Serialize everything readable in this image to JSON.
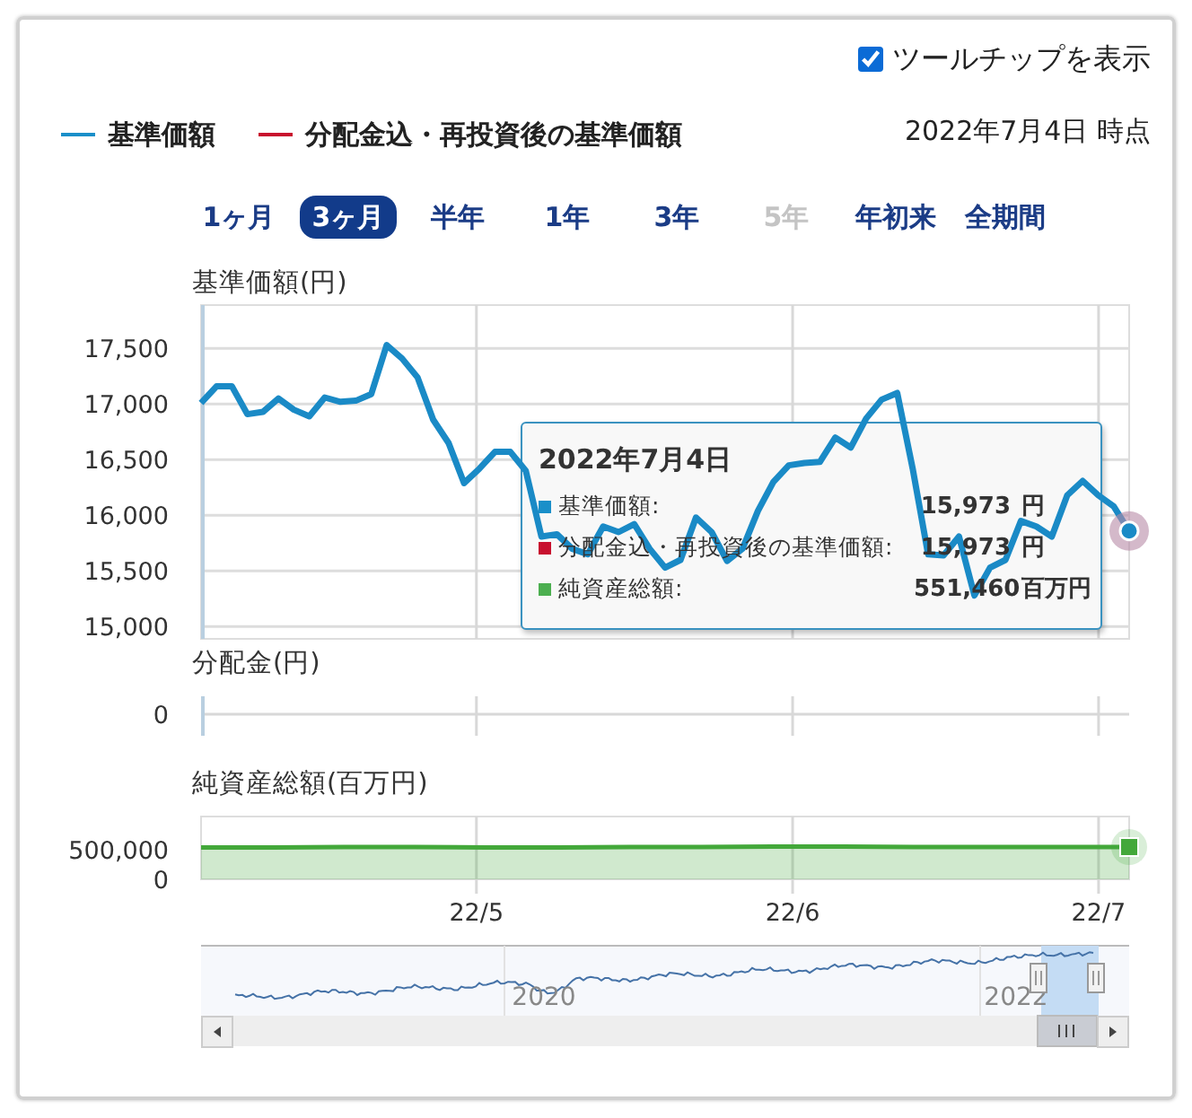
{
  "tooltip_toggle": {
    "label": "ツールチップを表示",
    "checked": true
  },
  "legend": [
    {
      "label": "基準価額",
      "color": "#1a8fc9"
    },
    {
      "label": "分配金込・再投資後の基準価額",
      "color": "#c8102e"
    }
  ],
  "as_of": "2022年7月4日 時点",
  "ranges": [
    {
      "label": "1ヶ月",
      "selected": false,
      "disabled": false
    },
    {
      "label": "3ヶ月",
      "selected": true,
      "disabled": false
    },
    {
      "label": "半年",
      "selected": false,
      "disabled": false
    },
    {
      "label": "1年",
      "selected": false,
      "disabled": false
    },
    {
      "label": "3年",
      "selected": false,
      "disabled": false
    },
    {
      "label": "5年",
      "selected": false,
      "disabled": true
    },
    {
      "label": "年初来",
      "selected": false,
      "disabled": false
    },
    {
      "label": "全期間",
      "selected": false,
      "disabled": false
    }
  ],
  "price_chart": {
    "title": "基準価額(円)",
    "chart_data": {
      "type": "line",
      "grid": true,
      "ylim": [
        14890,
        17890
      ],
      "yticks": [
        {
          "value": 15000,
          "label": "15,000"
        },
        {
          "value": 15500,
          "label": "15,500"
        },
        {
          "value": 16000,
          "label": "16,000"
        },
        {
          "value": 16500,
          "label": "16,500"
        },
        {
          "value": 17000,
          "label": "17,000"
        },
        {
          "value": 17500,
          "label": "17,500"
        }
      ],
      "series": [
        {
          "color": "#1a8ac6",
          "values": [
            17010,
            17160,
            17160,
            16910,
            16930,
            17050,
            16950,
            16890,
            17060,
            17020,
            17030,
            17090,
            17530,
            17410,
            17240,
            16860,
            16650,
            16290,
            16420,
            16570,
            16570,
            16400,
            15810,
            15830,
            15700,
            15650,
            15900,
            15850,
            15920,
            15700,
            15530,
            15600,
            15980,
            15850,
            15590,
            15700,
            16040,
            16300,
            16450,
            16470,
            16480,
            16700,
            16610,
            16870,
            17040,
            17100,
            16420,
            15650,
            15640,
            15810,
            15280,
            15530,
            15600,
            15950,
            15900,
            15810,
            16180,
            16310,
            16180,
            16080,
            15860
          ]
        }
      ]
    }
  },
  "distribution_chart": {
    "title": "分配金(円)",
    "ytick_labels": [
      "0"
    ]
  },
  "assets_chart": {
    "title": "純資産総額(百万円)",
    "chart_data": {
      "type": "area",
      "grid": true,
      "xlim": [
        "2022-04-04",
        "2022-07-04"
      ],
      "ylim": [
        0,
        1070000
      ],
      "yticks": [
        {
          "value": 0,
          "label": "0"
        },
        {
          "value": 500000,
          "label": "500,000"
        }
      ],
      "xticks": [
        {
          "value": "2022-05-01",
          "label": "22/5"
        },
        {
          "value": "2022-06-01",
          "label": "22/6"
        },
        {
          "value": "2022-07-01",
          "label": "22/7"
        }
      ],
      "x": [
        "2022-04-04",
        "2022-04-11",
        "2022-04-18",
        "2022-04-25",
        "2022-05-02",
        "2022-05-09",
        "2022-05-16",
        "2022-05-23",
        "2022-05-30",
        "2022-06-06",
        "2022-06-13",
        "2022-06-20",
        "2022-06-27",
        "2022-07-04"
      ],
      "series": [
        {
          "color": "#43a83a",
          "values": [
            540000,
            540000,
            550000,
            550000,
            540000,
            540000,
            550000,
            550000,
            560000,
            560000,
            550000,
            550000,
            550000,
            550000
          ]
        }
      ]
    }
  },
  "tooltip": {
    "title": "2022年7月4日",
    "rows": [
      {
        "label": "基準価額:",
        "value": "15,973",
        "unit": "円",
        "color": "#1a8fc9"
      },
      {
        "label": "分配金込・再投資後の基準価額:",
        "value": "15,973",
        "unit": "円",
        "color": "#c8102e"
      },
      {
        "label": "純資産総額:",
        "value": "551,460",
        "unit": "百万円",
        "color": "#4caf50"
      }
    ]
  },
  "navigator": {
    "labels": [
      "2020",
      "2022"
    ]
  }
}
